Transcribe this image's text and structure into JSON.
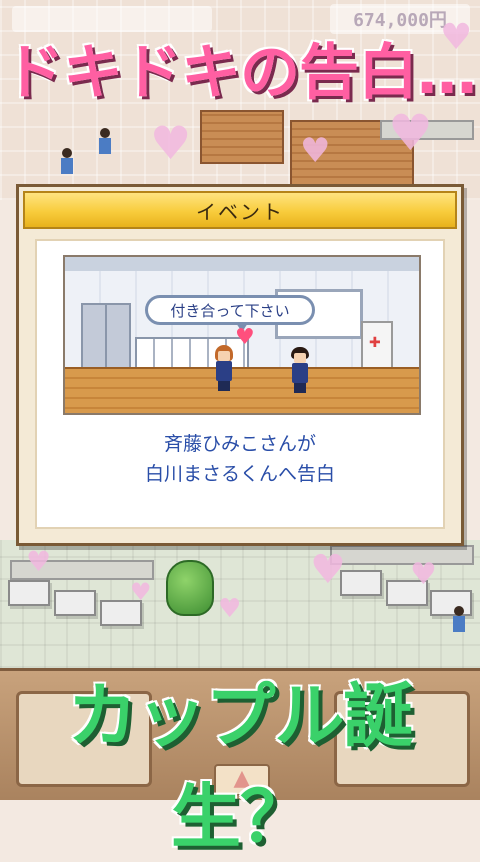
{
  "hud": {
    "money": "674,000円",
    "money_icon": "coin-icon"
  },
  "headline_top": "ドキドキの告白…",
  "headline_bottom": "カップル誕生？",
  "dialog": {
    "title": "イベント",
    "speech": "付き合って下さい",
    "caption_line1": "斉藤ひみこさんが",
    "caption_line2": "白川まさるくんへ告白"
  },
  "colors": {
    "headline_top": "#ff5fa2",
    "headline_bottom": "#3ad16a",
    "dialog_header": "#f8cc3c",
    "caption_text": "#2a4ea8"
  }
}
